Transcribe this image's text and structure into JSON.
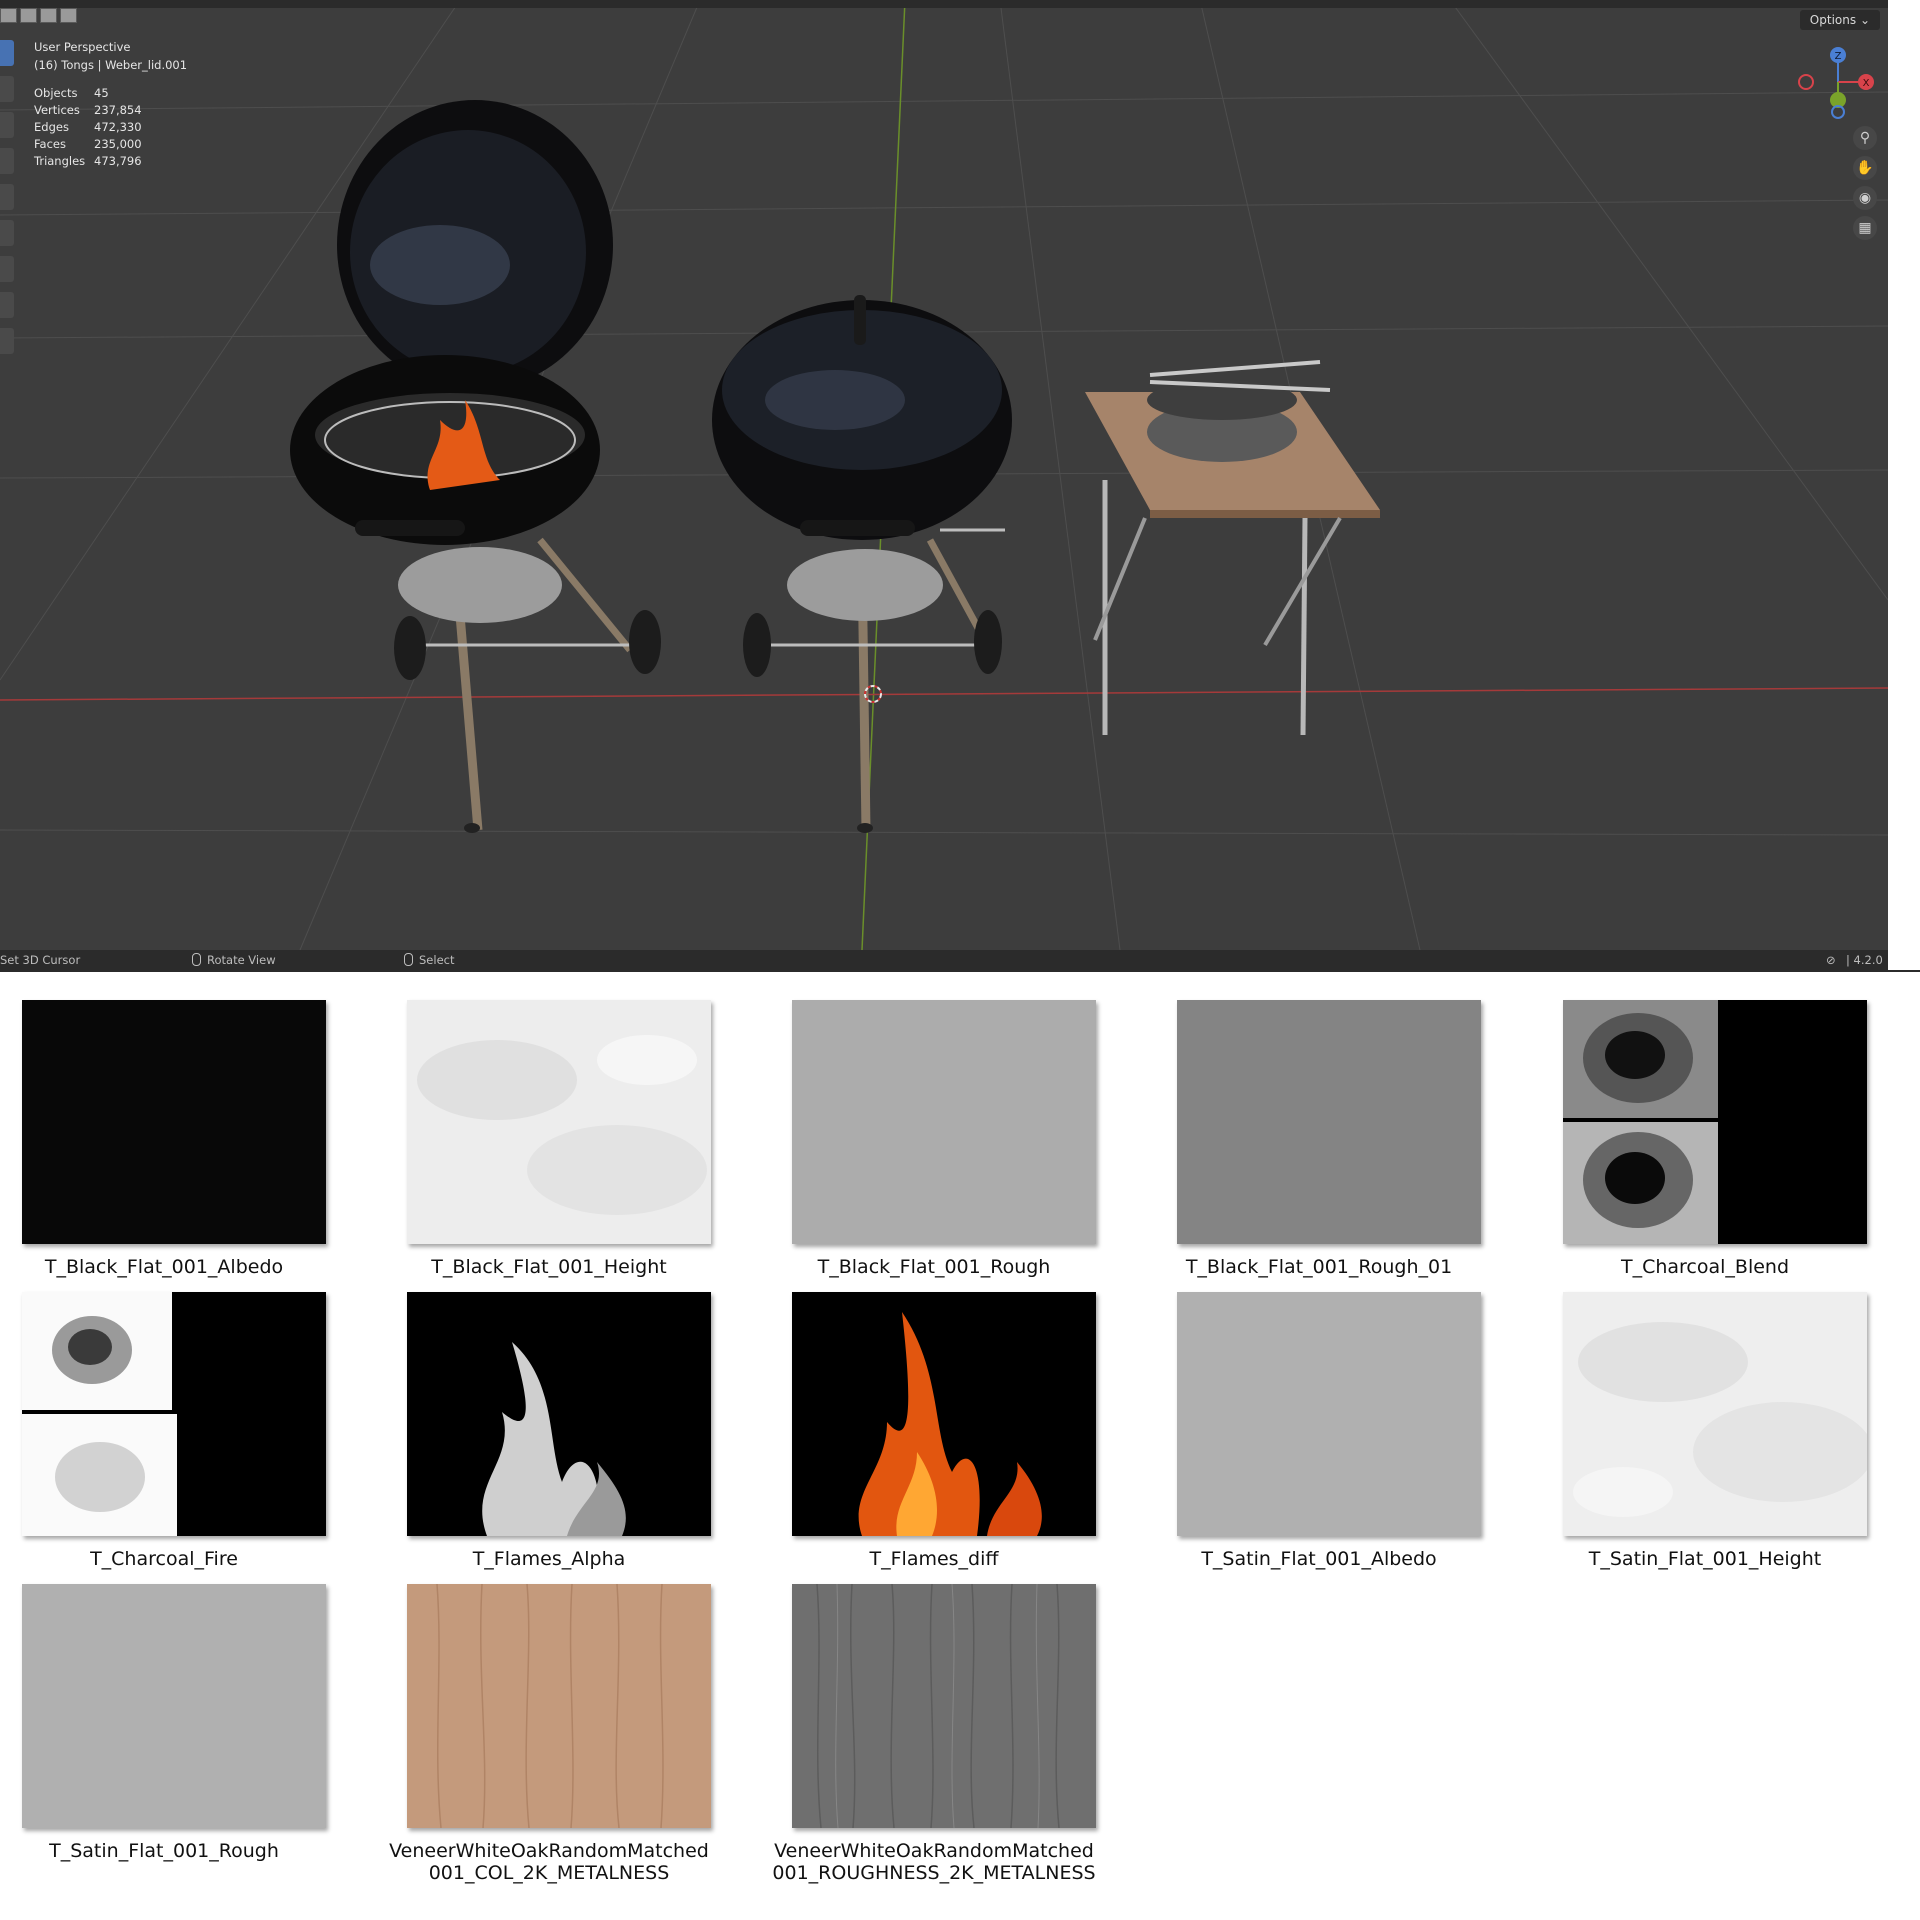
{
  "viewport": {
    "overlay": {
      "perspective": "User Perspective",
      "collection": "(16) Tongs | Weber_lid.001"
    },
    "stats": [
      {
        "label": "Objects",
        "value": "45"
      },
      {
        "label": "Vertices",
        "value": "237,854"
      },
      {
        "label": "Edges",
        "value": "472,330"
      },
      {
        "label": "Faces",
        "value": "235,000"
      },
      {
        "label": "Triangles",
        "value": "473,796"
      }
    ],
    "options_label": "Options",
    "gizmo": {
      "z": "Z",
      "x": "X"
    },
    "status": {
      "left": "Set 3D Cursor",
      "middle": "Rotate View",
      "right": "Select",
      "version": "4.2.0"
    }
  },
  "textures": [
    {
      "name": "T_Black_Flat_001_Albedo"
    },
    {
      "name": "T_Black_Flat_001_Height"
    },
    {
      "name": "T_Black_Flat_001_Rough"
    },
    {
      "name": "T_Black_Flat_001_Rough_01"
    },
    {
      "name": "T_Charcoal_Blend"
    },
    {
      "name": "T_Charcoal_Fire"
    },
    {
      "name": "T_Flames_Alpha"
    },
    {
      "name": "T_Flames_diff"
    },
    {
      "name": "T_Satin_Flat_001_Albedo"
    },
    {
      "name": "T_Satin_Flat_001_Height"
    },
    {
      "name": "T_Satin_Flat_001_Rough"
    },
    {
      "name": "VeneerWhiteOakRandomMatched 001_COL_2K_METALNESS"
    },
    {
      "name": "VeneerWhiteOakRandomMatched 001_ROUGHNESS_2K_METALNESS"
    }
  ]
}
